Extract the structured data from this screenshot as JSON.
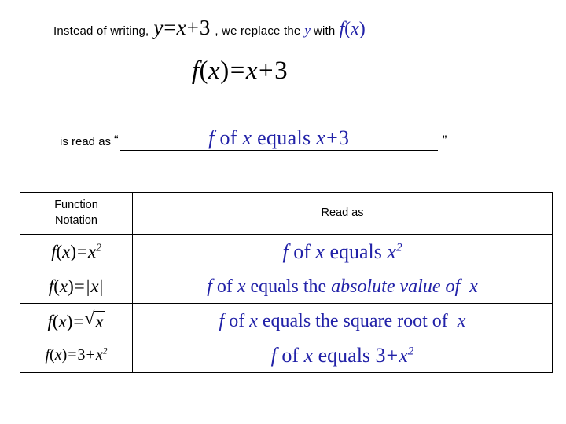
{
  "intro": {
    "lead_text": "Instead of writing,",
    "equation_y": {
      "lhs": "y",
      "eq": "=",
      "rhs_var": "x",
      "plus": "+",
      "const": "3"
    },
    "mid_text": ", we  replace the",
    "y_variable": "y",
    "with_text": "with",
    "fx_f": "f",
    "fx_open": "(",
    "fx_var": "x",
    "fx_close": ")"
  },
  "main_equation": {
    "f": "f",
    "open": "(",
    "var": "x",
    "close": ")",
    "eq": "=",
    "rhs_var": "x",
    "plus": "+",
    "const": "3"
  },
  "read_line": {
    "lead": "is read as",
    "quote_open": "“",
    "blank_f": "f",
    "blank_of": "of",
    "blank_var": "x",
    "blank_equals": "equals",
    "blank_rhs_var": "x",
    "blank_plus": "+",
    "blank_const": "3",
    "quote_close": "”"
  },
  "table": {
    "headers": {
      "col1_line1": "Function",
      "col1_line2": "Notation",
      "col2": "Read as"
    },
    "rows": [
      {
        "notation": {
          "f": "f",
          "open": "(",
          "var": "x",
          "close": ")",
          "eq": "=",
          "rhs_var": "x",
          "exp": "2"
        },
        "read_as": {
          "f": "f",
          "of": "of",
          "var": "x",
          "equals": "equals",
          "rhs_var": "x",
          "exp": "2"
        }
      },
      {
        "notation": {
          "f": "f",
          "open": "(",
          "var": "x",
          "close": ")",
          "eq": "=",
          "bar": "|",
          "rhs_var": "x"
        },
        "read_as": {
          "f": "f",
          "of": "of",
          "var": "x",
          "equals": "equals",
          "the": "the",
          "phrase": "absolute value of",
          "tail_var": "x"
        }
      },
      {
        "notation": {
          "f": "f",
          "open": "(",
          "var": "x",
          "close": ")",
          "eq": "=",
          "radicand": "x"
        },
        "read_as": {
          "f": "f",
          "of": "of",
          "var": "x",
          "equals": "equals",
          "the": "the",
          "phrase": "square root of",
          "tail_var": "x"
        }
      },
      {
        "notation": {
          "f": "f",
          "open": "(",
          "var": "x",
          "close": ")",
          "eq": "=",
          "const": "3",
          "plus": "+",
          "rhs_var": "x",
          "exp": "2"
        },
        "read_as": {
          "f": "f",
          "of": "of",
          "var": "x",
          "equals": "equals",
          "const": "3",
          "plus": "+",
          "rhs_var": "x",
          "exp": "2"
        }
      }
    ]
  },
  "colors": {
    "blue": "#2222A8",
    "black": "#000000",
    "border": "#000000"
  }
}
